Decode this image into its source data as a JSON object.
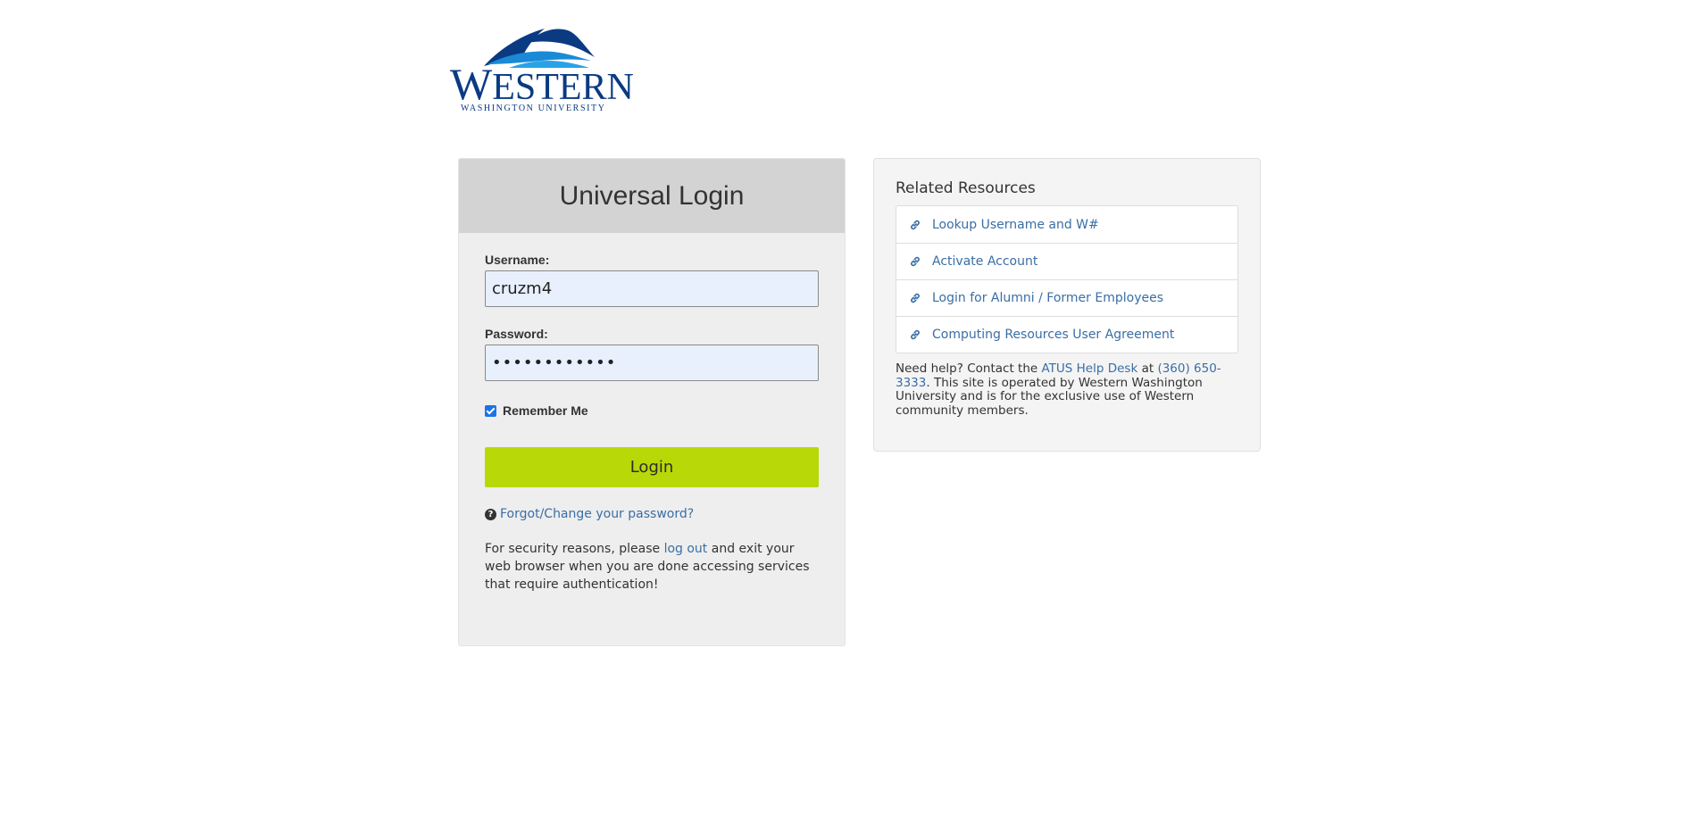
{
  "logo": {
    "wordmark_initial": "W",
    "wordmark_rest": "ESTERN",
    "subtitle": "WASHINGTON UNIVERSITY"
  },
  "login": {
    "title": "Universal Login",
    "username_label": "Username:",
    "username_value": "cruzm4",
    "password_label": "Password:",
    "password_mask": "••••••••••••",
    "remember_label": "Remember Me",
    "remember_checked": true,
    "login_button": "Login",
    "forgot_link": "Forgot/Change your password?",
    "security_prefix": "For security reasons, please ",
    "security_link": "log out",
    "security_suffix": " and exit your web browser when you are done accessing services that require authentication!"
  },
  "resources": {
    "title": "Related Resources",
    "items": [
      {
        "label": "Lookup Username and W#"
      },
      {
        "label": "Activate Account"
      },
      {
        "label": "Login for Alumni / Former Employees"
      },
      {
        "label": "Computing Resources User Agreement"
      }
    ],
    "help_prefix": "Need help? Contact the ",
    "help_desk_link": "ATUS Help Desk",
    "help_at": " at ",
    "phone_link": "(360) 650-3333",
    "help_suffix": ". This site is operated by Western Washington University and is for the exclusive use of Western community members."
  },
  "colors": {
    "login_button": "#b9d808",
    "link": "#3a6ea5",
    "brand_navy": "#0a3a82",
    "brand_blue": "#1a8ad6"
  }
}
